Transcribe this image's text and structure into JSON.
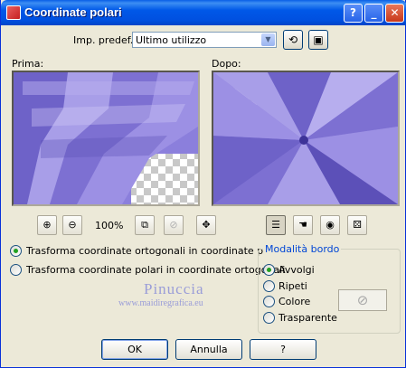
{
  "window": {
    "title": "Coordinate polari"
  },
  "titlebar_buttons": {
    "help": "?",
    "minimize": "_",
    "close": "✕"
  },
  "preset": {
    "label": "Imp. predef.:",
    "value": "Ultimo utilizzo"
  },
  "previews": {
    "before_label": "Prima:",
    "after_label": "Dopo:"
  },
  "zoom": {
    "value": "100%"
  },
  "options": {
    "rect_to_polar": "Trasforma coordinate ortogonali in coordinate polari",
    "polar_to_rect": "Trasforma coordinate polari in coordinate ortogonali",
    "selected": "rect_to_polar"
  },
  "edge_mode": {
    "title": "Modalità bordo",
    "items": [
      "Avvolgi",
      "Ripeti",
      "Colore",
      "Trasparente"
    ],
    "selected": "Avvolgi"
  },
  "watermark": {
    "name": "Pinuccia",
    "url": "www.maidiregrafica.eu"
  },
  "buttons": {
    "ok": "OK",
    "cancel": "Annulla",
    "help": "?"
  },
  "colors": {
    "accent_purple": "#8378d4",
    "selected_radio": "#21a121",
    "titlebar": "#0058e8"
  }
}
